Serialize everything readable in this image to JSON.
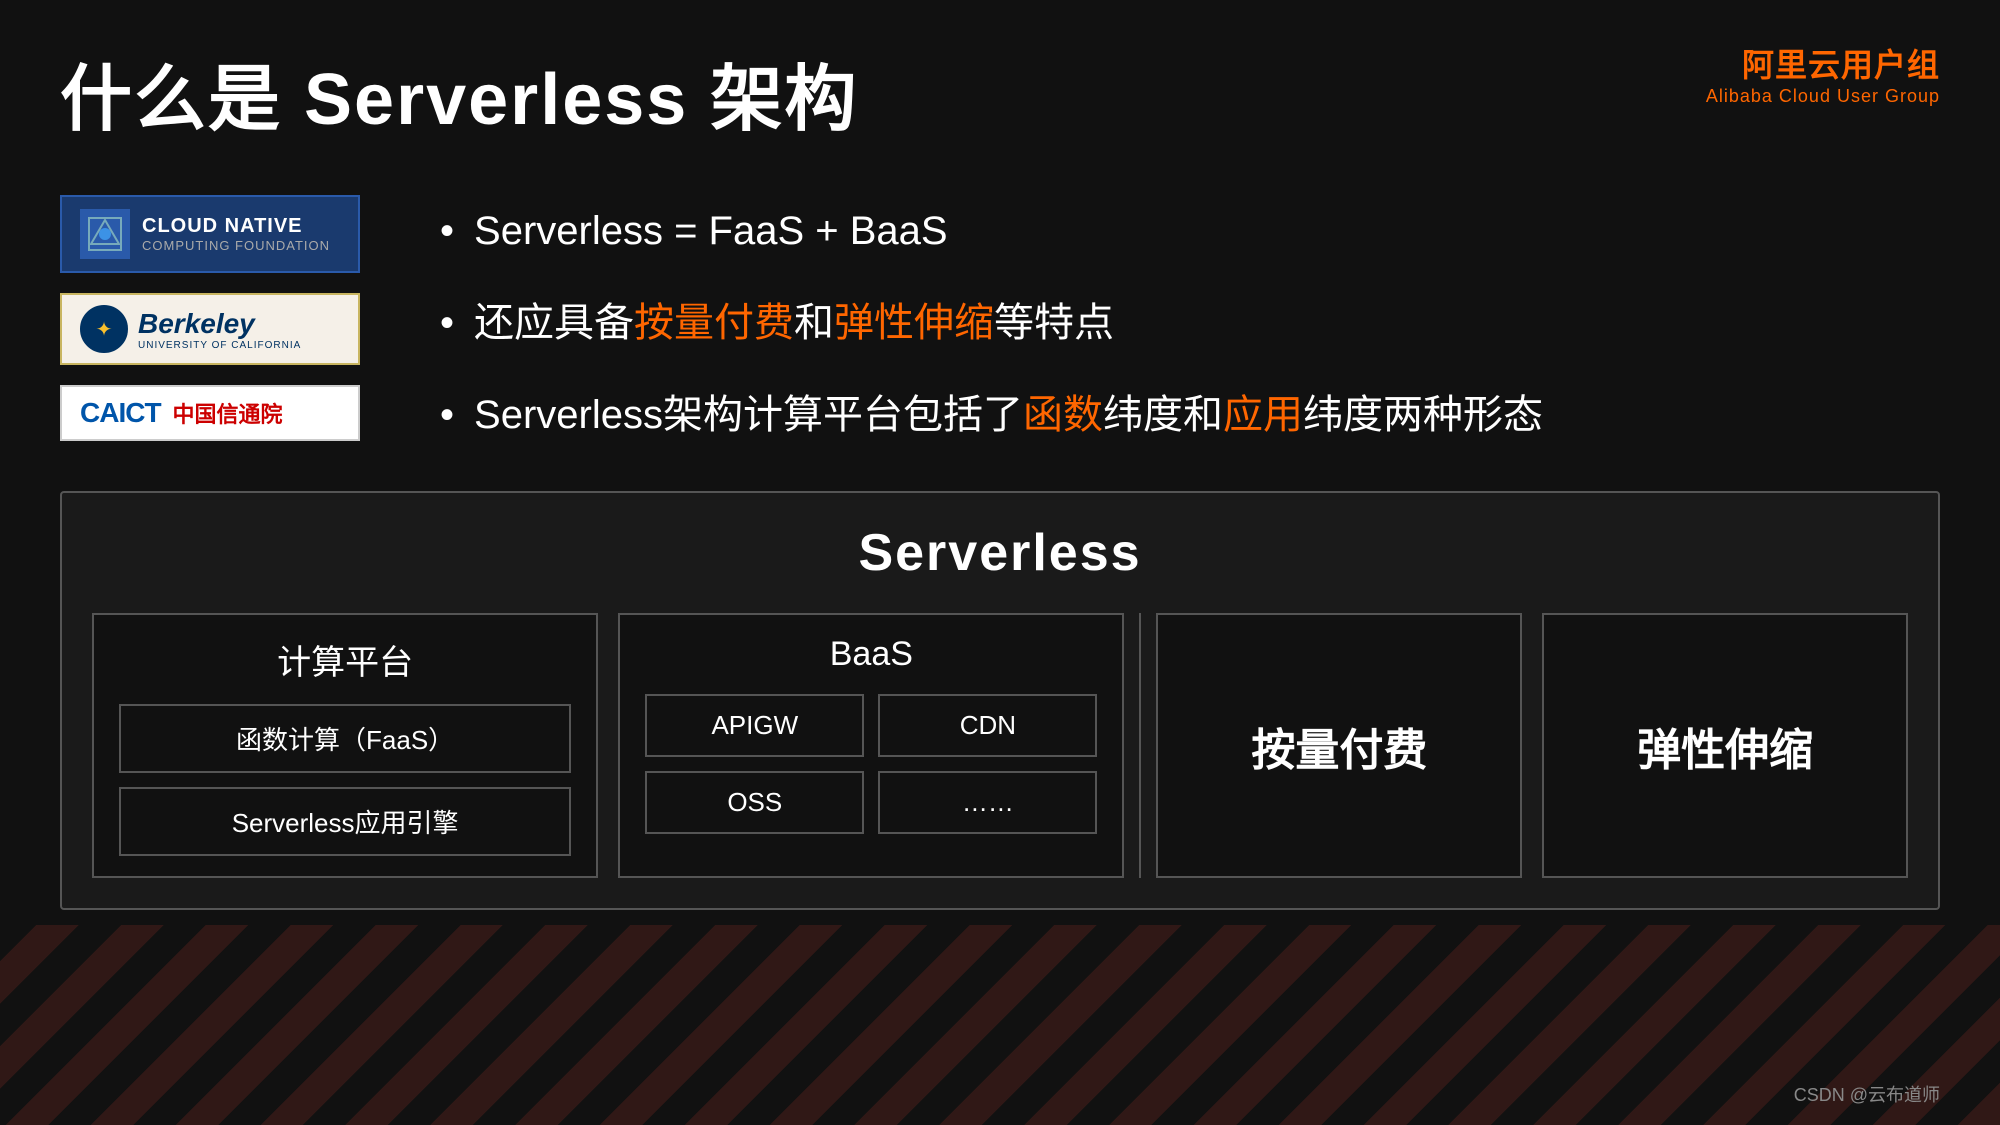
{
  "page": {
    "title": "什么是 Serverless 架构",
    "background_color": "#111111"
  },
  "brand": {
    "name": "阿里云用户组",
    "subtitle": "Alibaba Cloud User Group",
    "color": "#ff6600"
  },
  "logos": [
    {
      "id": "cncf",
      "abbr": "CLOUD NATIVE",
      "sub": "COMPUTING FOUNDATION",
      "type": "cncf"
    },
    {
      "id": "berkeley",
      "name": "Berkeley",
      "sub": "UNIVERSITY OF CALIFORNIA",
      "type": "berkeley"
    },
    {
      "id": "caict",
      "abbr": "CAICT",
      "name": "中国信通院",
      "type": "caict"
    }
  ],
  "bullets": [
    {
      "id": "bullet1",
      "text_parts": [
        {
          "text": "Serverless = FaaS + BaaS",
          "highlight": false
        }
      ]
    },
    {
      "id": "bullet2",
      "text_parts": [
        {
          "text": "还应具备",
          "highlight": false
        },
        {
          "text": "按量付费",
          "highlight": true
        },
        {
          "text": "和",
          "highlight": false
        },
        {
          "text": "弹性伸缩",
          "highlight": true
        },
        {
          "text": "等特点",
          "highlight": false
        }
      ]
    },
    {
      "id": "bullet3",
      "text_parts": [
        {
          "text": "Serverless架构计算平台包括了",
          "highlight": false
        },
        {
          "text": "函数",
          "highlight": true
        },
        {
          "text": "纬度和",
          "highlight": false
        },
        {
          "text": "应用",
          "highlight": true
        },
        {
          "text": "纬度两种形态",
          "highlight": false
        }
      ]
    }
  ],
  "diagram": {
    "title": "Serverless",
    "sections": [
      {
        "id": "compute",
        "title": "计算平台",
        "items": [
          "函数计算（FaaS）",
          "Serverless应用引擎"
        ]
      },
      {
        "id": "baas",
        "title": "BaaS",
        "items": [
          "APIGW",
          "CDN",
          "OSS",
          "……"
        ]
      },
      {
        "id": "billing",
        "title": "按量付费"
      },
      {
        "id": "scaling",
        "title": "弹性伸缩"
      }
    ]
  },
  "footer": {
    "credit": "CSDN @云布道师"
  }
}
